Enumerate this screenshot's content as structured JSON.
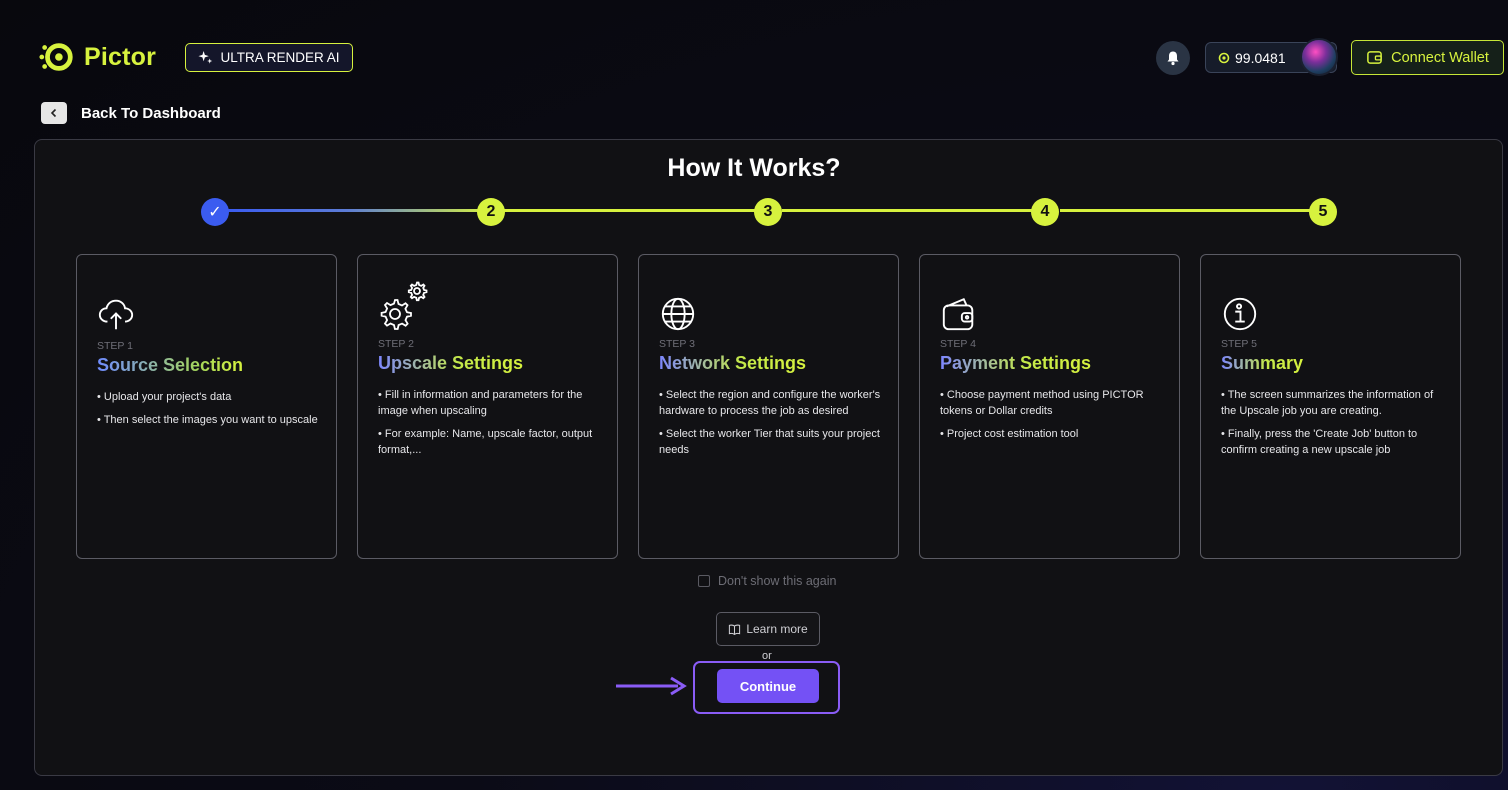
{
  "header": {
    "logo_text": "Pictor",
    "product_badge": "ULTRA RENDER AI",
    "balance": "99.0481",
    "connect_wallet": "Connect Wallet"
  },
  "nav": {
    "back_label": "Back To Dashboard"
  },
  "main": {
    "title": "How It Works?",
    "stepper": [
      "✓",
      "2",
      "3",
      "4",
      "5"
    ],
    "cards": [
      {
        "icon": "cloud-upload-icon",
        "step": "STEP 1",
        "title": "Source Selection",
        "bullets": [
          "• Upload your project's data",
          "• Then select the images you want to upscale"
        ]
      },
      {
        "icon": "gears-icon",
        "step": "STEP 2",
        "title": "Upscale Settings",
        "bullets": [
          "• Fill in information and parameters for the image when upscaling",
          "• For example: Name, upscale factor, output format,..."
        ]
      },
      {
        "icon": "globe-icon",
        "step": "STEP 3",
        "title": "Network Settings",
        "bullets": [
          "• Select the region and configure the worker's hardware to process the job as desired",
          "• Select the worker Tier that suits your project needs"
        ]
      },
      {
        "icon": "wallet-icon",
        "step": "STEP 4",
        "title": "Payment Settings",
        "bullets": [
          "• Choose payment method using PICTOR tokens or Dollar credits",
          "• Project cost estimation tool"
        ]
      },
      {
        "icon": "info-icon",
        "step": "STEP 5",
        "title": "Summary",
        "bullets": [
          "• The screen summarizes the information of the Upscale job you are creating.",
          "• Finally, press the 'Create Job' button to confirm creating a new upscale job"
        ]
      }
    ],
    "dont_show": "Don't show this again",
    "learn_more": "Learn more",
    "or": "or",
    "continue": "Continue"
  },
  "colors": {
    "accent": "#d7f23e",
    "step_done": "#3b5cf0",
    "continue": "#7451f5",
    "highlight": "#8a5cf6"
  }
}
